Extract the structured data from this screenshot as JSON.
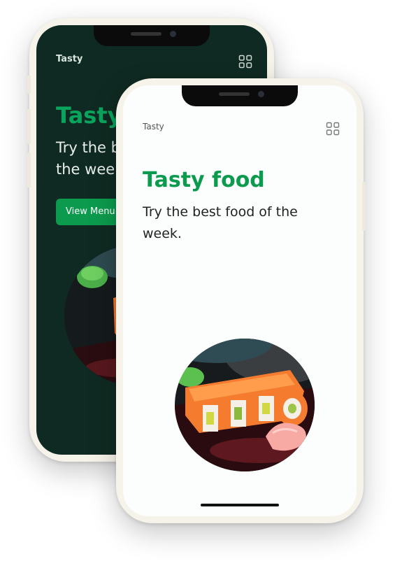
{
  "back_screen": {
    "app_name": "Tasty",
    "title": "Tasty",
    "subtitle_line1": "Try the b",
    "subtitle_line2": "the week",
    "button_label": "View Menu",
    "menu_icon": "grid-icon"
  },
  "front_screen": {
    "app_name": "Tasty",
    "title": "Tasty food",
    "subtitle": "Try the best food of the week.",
    "menu_icon": "grid-icon",
    "image": "sushi-plate"
  },
  "colors": {
    "accent": "#0c9b4e",
    "dark_background": "#0f2a22",
    "light_background": "#fbfefd"
  }
}
